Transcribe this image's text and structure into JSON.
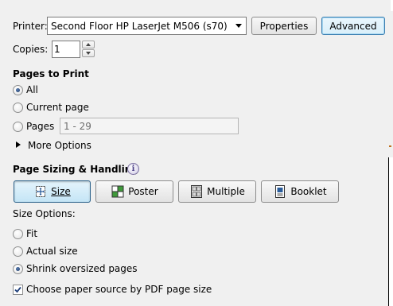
{
  "printer": {
    "label": "Printer:",
    "selected": "Second Floor HP LaserJet M506 (s70)",
    "properties_label": "Properties",
    "advanced_label": "Advanced"
  },
  "copies": {
    "label": "Copies:",
    "value": "1"
  },
  "pages_to_print": {
    "heading": "Pages to Print",
    "all_label": "All",
    "current_page_label": "Current page",
    "pages_label": "Pages",
    "pages_placeholder": "1 - 29",
    "more_options_label": "More Options",
    "selected": "All"
  },
  "page_sizing": {
    "heading": "Page Sizing & Handling",
    "modes": [
      {
        "label": "Size",
        "icon": "size-icon",
        "active": true
      },
      {
        "label": "Poster",
        "icon": "poster-icon",
        "active": false
      },
      {
        "label": "Multiple",
        "icon": "multiple-icon",
        "active": false
      },
      {
        "label": "Booklet",
        "icon": "booklet-icon",
        "active": false
      }
    ],
    "size_options_label": "Size Options:",
    "fit_label": "Fit",
    "actual_size_label": "Actual size",
    "shrink_label": "Shrink oversized pages",
    "selected_size_option": "Shrink oversized pages",
    "paper_source_label": "Choose paper source by PDF page size",
    "paper_source_checked": true
  },
  "colors": {
    "accent_border": "#3c7fb1",
    "pressed_bg": "#c4e5f6",
    "window_bg": "#f0f0f0"
  }
}
